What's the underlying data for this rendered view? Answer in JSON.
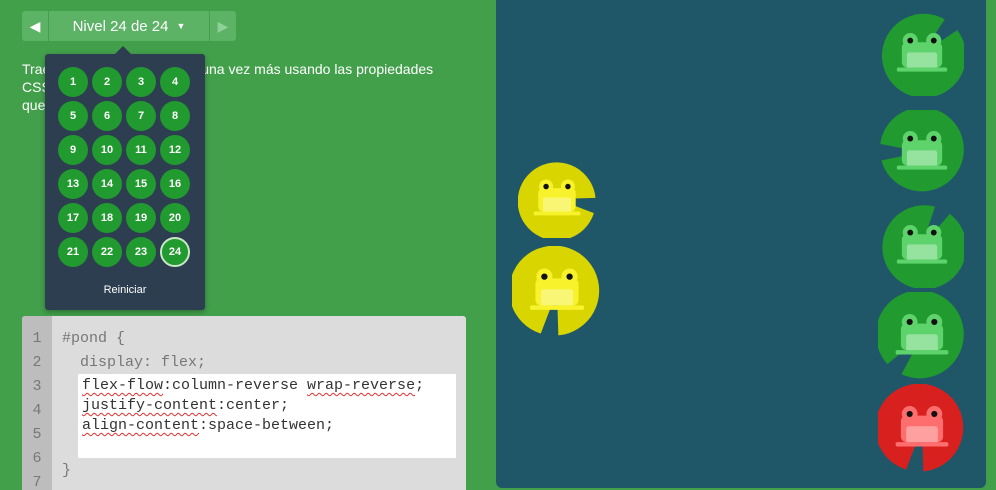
{
  "nav": {
    "prev_icon": "◀",
    "next_icon": "▶",
    "level_label": "Nivel 24 de 24",
    "caret_icon": "▼"
  },
  "instructions": {
    "line1": "Trae a las ranas a sus hojas una vez más usando las propiedades CSS",
    "line2": "que has aprendido:"
  },
  "level_menu": {
    "levels": [
      "1",
      "2",
      "3",
      "4",
      "5",
      "6",
      "7",
      "8",
      "9",
      "10",
      "11",
      "12",
      "13",
      "14",
      "15",
      "16",
      "17",
      "18",
      "19",
      "20",
      "21",
      "22",
      "23",
      "24"
    ],
    "current": "24",
    "reset_label": "Reiniciar"
  },
  "editor": {
    "line_numbers": [
      "1",
      "2",
      "3",
      "4",
      "5",
      "6",
      "7"
    ],
    "line1": "#pond {",
    "line2": "  display: flex;",
    "input1_a": "flex-flow",
    "input1_b": ":column-reverse ",
    "input1_c": "wrap-reverse",
    "input1_d": ";",
    "input2_a": "justify-content",
    "input2_b": ":center;",
    "input3_a": "align-content",
    "input3_b": ":space-between;",
    "line7": "}"
  },
  "colors": {
    "background": "#42a04b",
    "pond": "#1f5768",
    "green_lily": "#219a2f",
    "green_frog": "#5ed36c",
    "yellow_lily": "#d9d500",
    "yellow_frog": "#f7f22b",
    "red_lily": "#d8201f",
    "red_frog": "#ff6e6e"
  }
}
